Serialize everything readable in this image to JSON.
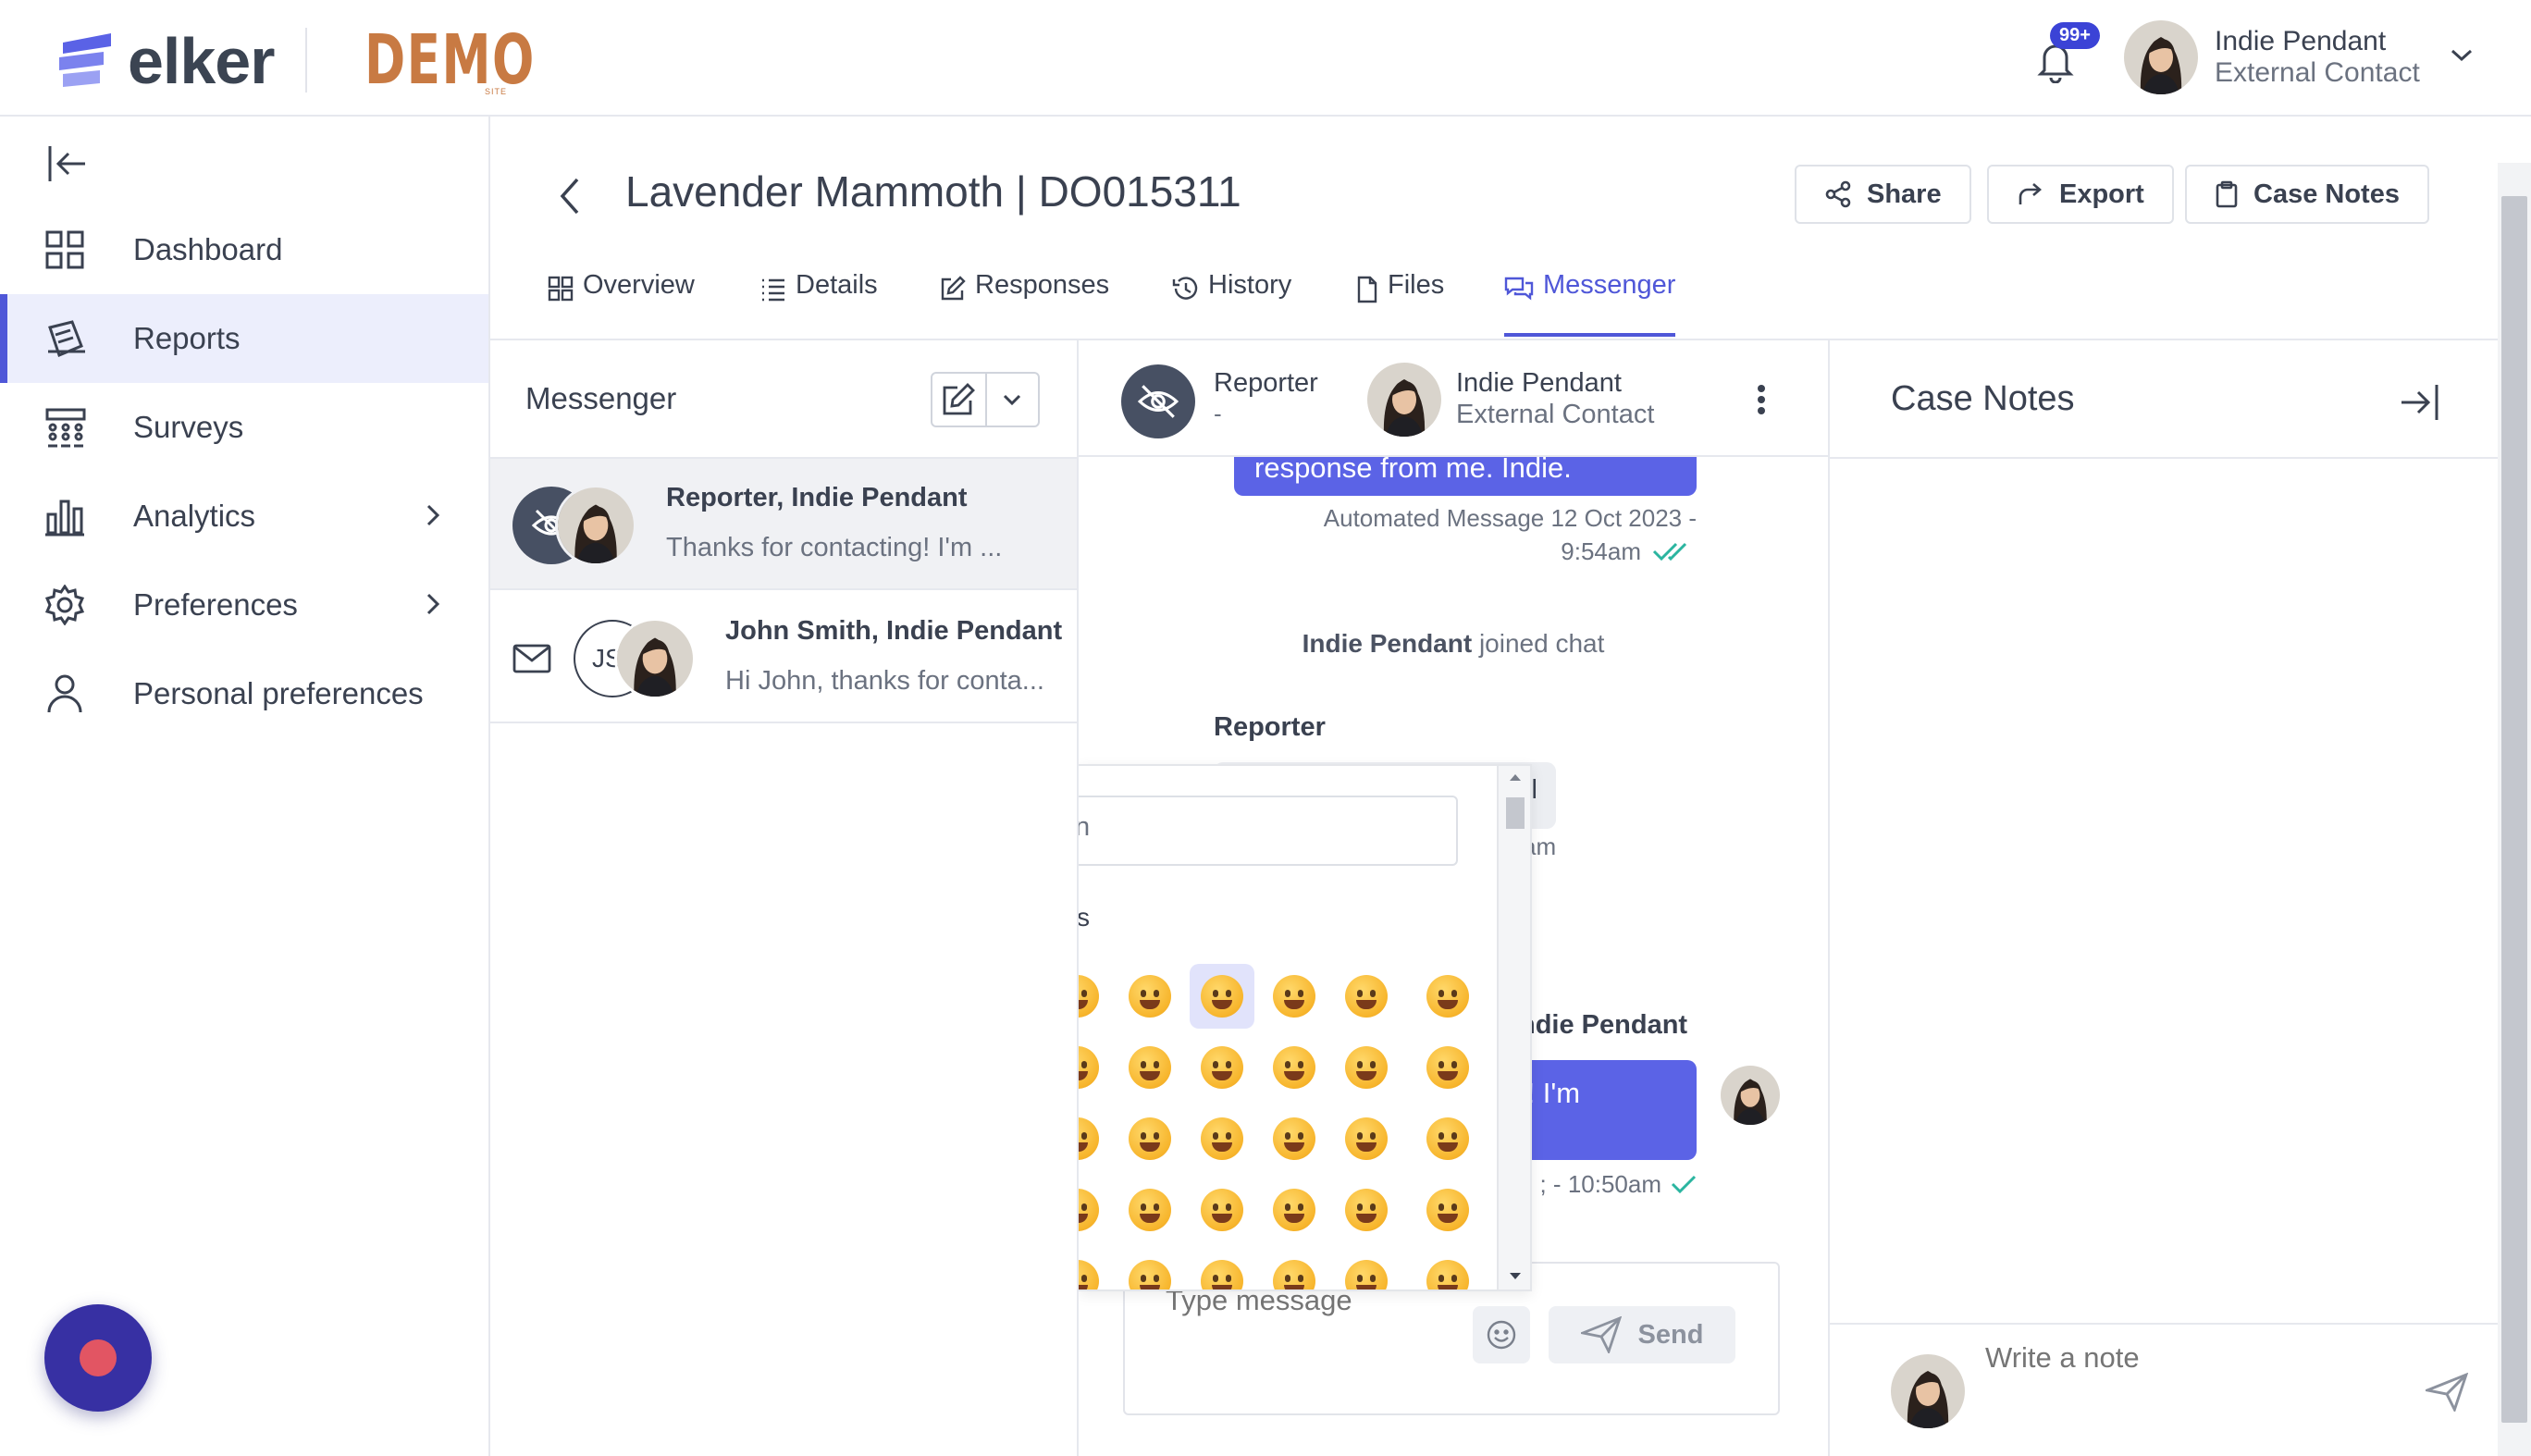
{
  "brand": {
    "logo_text": "elker",
    "demo_label": "DEMO",
    "demo_sub": "SITE",
    "accent": "#4f57d8",
    "logo_color": "#4f57d8",
    "demo_color": "#c87a43"
  },
  "header": {
    "notifications_badge": "99+",
    "user_name": "Indie Pendant",
    "user_role": "External Contact"
  },
  "sidebar": {
    "items": [
      {
        "label": "Dashboard",
        "icon": "grid-icon",
        "active": false,
        "has_submenu": false
      },
      {
        "label": "Reports",
        "icon": "reports-icon",
        "active": true,
        "has_submenu": false
      },
      {
        "label": "Surveys",
        "icon": "surveys-icon",
        "active": false,
        "has_submenu": false
      },
      {
        "label": "Analytics",
        "icon": "chart-icon",
        "active": false,
        "has_submenu": true
      },
      {
        "label": "Preferences",
        "icon": "gear-icon",
        "active": false,
        "has_submenu": true
      },
      {
        "label": "Personal preferences",
        "icon": "user-icon",
        "active": false,
        "has_submenu": false
      }
    ]
  },
  "page": {
    "title": "Lavender Mammoth | DO015311",
    "actions": {
      "share": "Share",
      "export": "Export",
      "case_notes": "Case Notes"
    },
    "tabs": [
      "Overview",
      "Details",
      "Responses",
      "History",
      "Files",
      "Messenger"
    ],
    "active_tab": "Messenger"
  },
  "messenger": {
    "title": "Messenger",
    "conversations": [
      {
        "name": "Reporter, Indie Pendant",
        "preview": "Thanks for contacting! I'm ...",
        "selected": true
      },
      {
        "name": "John Smith, Indie Pendant",
        "preview": "Hi John, thanks for conta...",
        "initials": "JS",
        "selected": false
      }
    ]
  },
  "chat": {
    "participants": [
      {
        "name": "Reporter",
        "sub": "-"
      },
      {
        "name": "Indie Pendant",
        "sub": "External Contact"
      }
    ],
    "messages": {
      "top_bubble_text": "response from me. Indie.",
      "top_meta_line1": "Automated Message 12 Oct 2023 -",
      "top_meta_line2": "9:54am",
      "joined_name": "Indie Pendant",
      "joined_text": " joined chat",
      "reporter_label": "Reporter",
      "reporter_bubble_partial": "l",
      "reporter_meta_partial": "am",
      "ip_label_partial": "ndie Pendant",
      "ip_bubble_partial": "ng! I'm",
      "ip_meta_partial": "; - 10:50am"
    },
    "composer": {
      "placeholder": "Type message",
      "send_label": "Send"
    },
    "emoji_picker": {
      "search_partial": "n",
      "category_partial": "s"
    }
  },
  "case_notes": {
    "title": "Case Notes",
    "placeholder": "Write a note"
  }
}
